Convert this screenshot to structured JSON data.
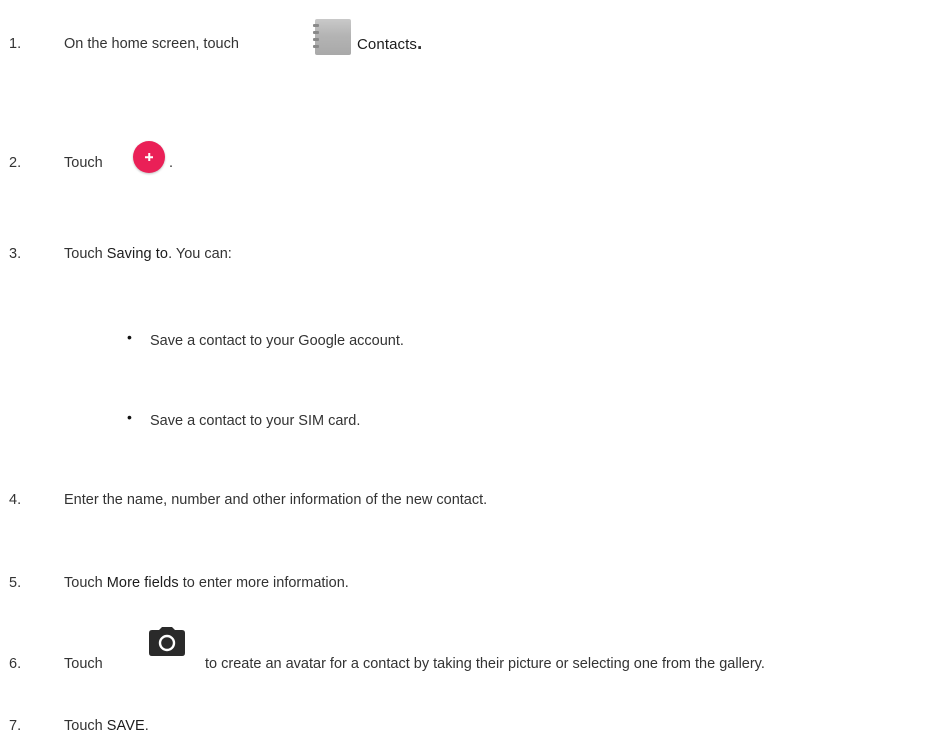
{
  "steps": [
    {
      "number": "1.",
      "text_before": "On the home screen, touch",
      "bold": "Contacts",
      "text_after": "."
    },
    {
      "number": "2.",
      "text_before": "Touch",
      "text_after": "."
    },
    {
      "number": "3.",
      "text_before": "Touch ",
      "bold": "Saving to",
      "text_after": ". You can:"
    },
    {
      "number": "4.",
      "text": "Enter the name, number and other information of the new contact."
    },
    {
      "number": "5.",
      "text_before": "Touch ",
      "bold": "More fields",
      "text_after": " to enter more information."
    },
    {
      "number": "6.",
      "text_before": "Touch",
      "text_after": "to create an avatar for a contact by taking their picture or selecting one from the gallery."
    },
    {
      "number": "7.",
      "text_before": "Touch ",
      "bold": "SAVE",
      "text_after": "."
    }
  ],
  "bullets": [
    {
      "symbol": "•",
      "text": "Save a contact to your Google account."
    },
    {
      "symbol": "•",
      "text": "Save a contact to your SIM card."
    }
  ],
  "icons": {
    "contacts": "contacts-app-icon",
    "add": "add-contact-fab-icon",
    "camera": "camera-icon"
  },
  "colors": {
    "fab": "#ea2057",
    "text": "#333333"
  }
}
